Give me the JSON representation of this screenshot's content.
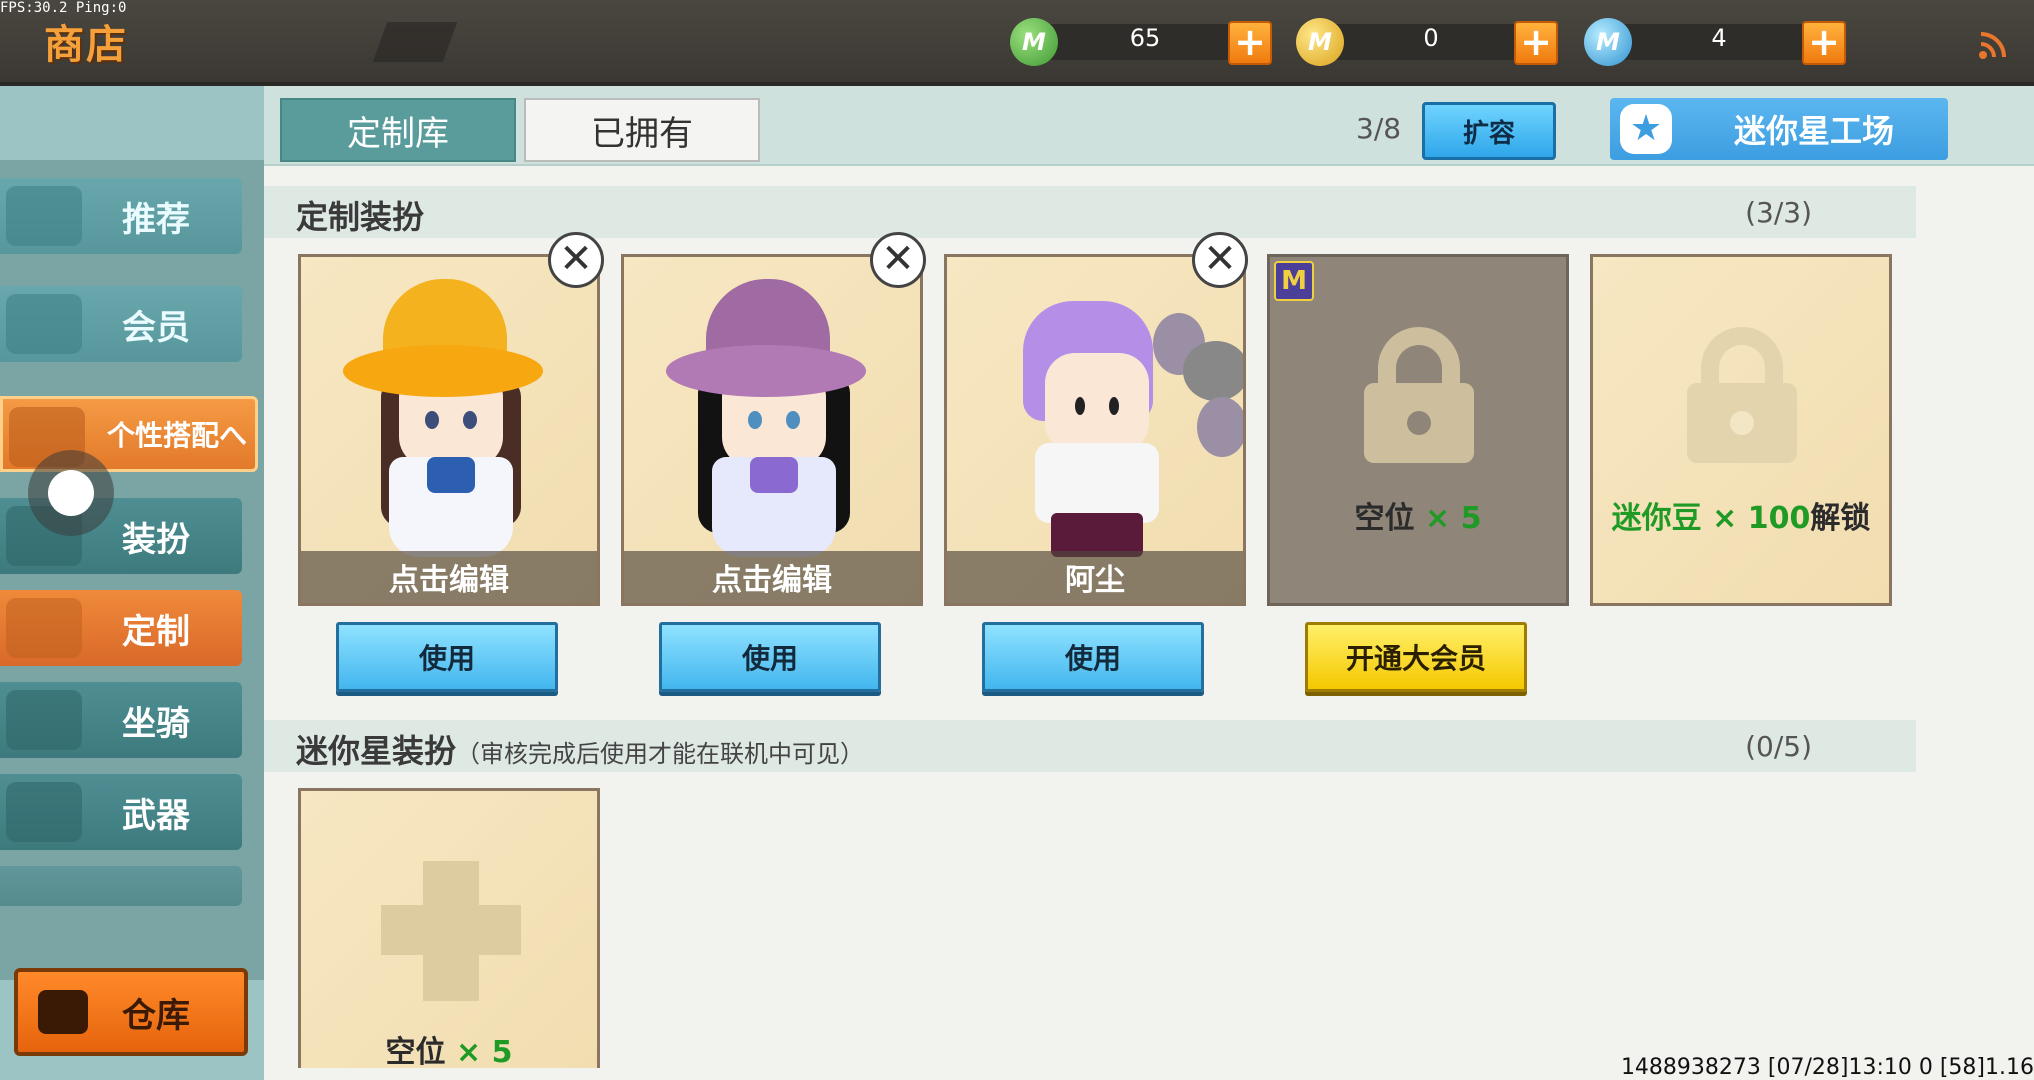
{
  "status": {
    "fps": "FPS:30.2  Ping:0"
  },
  "header": {
    "title": "商店",
    "currencies": [
      {
        "icon": "mini-coin-green-icon",
        "letter": "M",
        "value": "65",
        "color": "#56b84a"
      },
      {
        "icon": "mini-coin-gold-icon",
        "letter": "M",
        "value": "0",
        "color": "#e9b52a"
      },
      {
        "icon": "mini-coin-blue-icon",
        "letter": "M",
        "value": "4",
        "color": "#4fb0e6"
      }
    ],
    "plus_label": "+"
  },
  "sidebar": {
    "items": [
      {
        "label": "推荐"
      },
      {
        "label": "会员"
      },
      {
        "label": "个性搭配へ"
      },
      {
        "label": "装扮"
      },
      {
        "label": "定制"
      },
      {
        "label": "坐骑"
      },
      {
        "label": "武器"
      }
    ],
    "warehouse_label": "仓库"
  },
  "tabs": {
    "items": [
      {
        "label": "定制库"
      },
      {
        "label": "已拥有"
      }
    ],
    "capacity": "3/8",
    "expand_label": "扩容",
    "workshop_label": "迷你星工场"
  },
  "custom_section": {
    "title": "定制装扮",
    "count": "(3/3)",
    "cards": [
      {
        "name": "点击编辑",
        "button": "使用"
      },
      {
        "name": "点击编辑",
        "button": "使用"
      },
      {
        "name": "阿尘",
        "button": "使用"
      }
    ],
    "locked_member": {
      "slot_prefix": "空位",
      "slot_suffix": "× 5",
      "button": "开通大会员",
      "badge": "M"
    },
    "locked_beans": {
      "green_part": "迷你豆 × 100",
      "suffix": "解锁"
    }
  },
  "star_section": {
    "title": "迷你星装扮",
    "note": "（审核完成后使用才能在联机中可见）",
    "count": "(0/5)",
    "slot_prefix": "空位",
    "slot_suffix": "× 5"
  },
  "close_label": "✕",
  "footer": {
    "info": "1488938273   [07/28]13:10 0   [58]1.16"
  },
  "colors": {
    "accent_orange": "#f08a3a",
    "teal": "#5a9c9b",
    "blue_button": "#43b6ee",
    "yellow_button": "#f5c800"
  }
}
